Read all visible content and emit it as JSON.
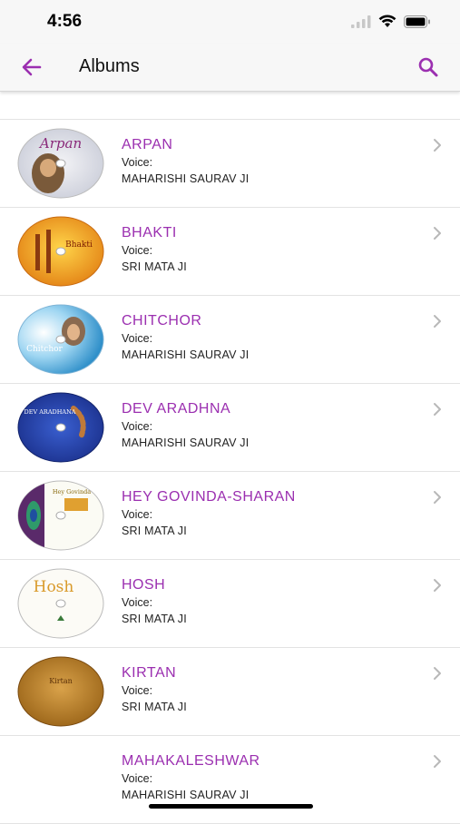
{
  "status_bar": {
    "time": "4:56"
  },
  "nav": {
    "title": "Albums"
  },
  "colors": {
    "accent": "#9b2fb0",
    "background": "#ffffff",
    "bar": "#f7f7f7"
  },
  "albums": [
    {
      "title": "ARPAN",
      "voice_label": "Voice:",
      "voice": "MAHARISHI SAURAV JI",
      "cover_text": "Arpan"
    },
    {
      "title": "BHAKTI",
      "voice_label": "Voice:",
      "voice": "SRI MATA JI",
      "cover_text": "Bhakti"
    },
    {
      "title": "CHITCHOR",
      "voice_label": "Voice:",
      "voice": "MAHARISHI SAURAV JI",
      "cover_text": "Chitchor"
    },
    {
      "title": "DEV ARADHNA",
      "voice_label": "Voice:",
      "voice": "MAHARISHI SAURAV JI",
      "cover_text": "DEV ARADHANA"
    },
    {
      "title": "HEY GOVINDA-SHARAN",
      "voice_label": "Voice:",
      "voice": "SRI MATA JI",
      "cover_text": "Hey Govinda"
    },
    {
      "title": "HOSH",
      "voice_label": "Voice:",
      "voice": "SRI MATA JI",
      "cover_text": "Hosh"
    },
    {
      "title": "KIRTAN",
      "voice_label": "Voice:",
      "voice": "SRI MATA JI",
      "cover_text": "Kirtan"
    },
    {
      "title": "MAHAKALESHWAR",
      "voice_label": "Voice:",
      "voice": "MAHARISHI SAURAV JI",
      "cover_text": ""
    }
  ]
}
